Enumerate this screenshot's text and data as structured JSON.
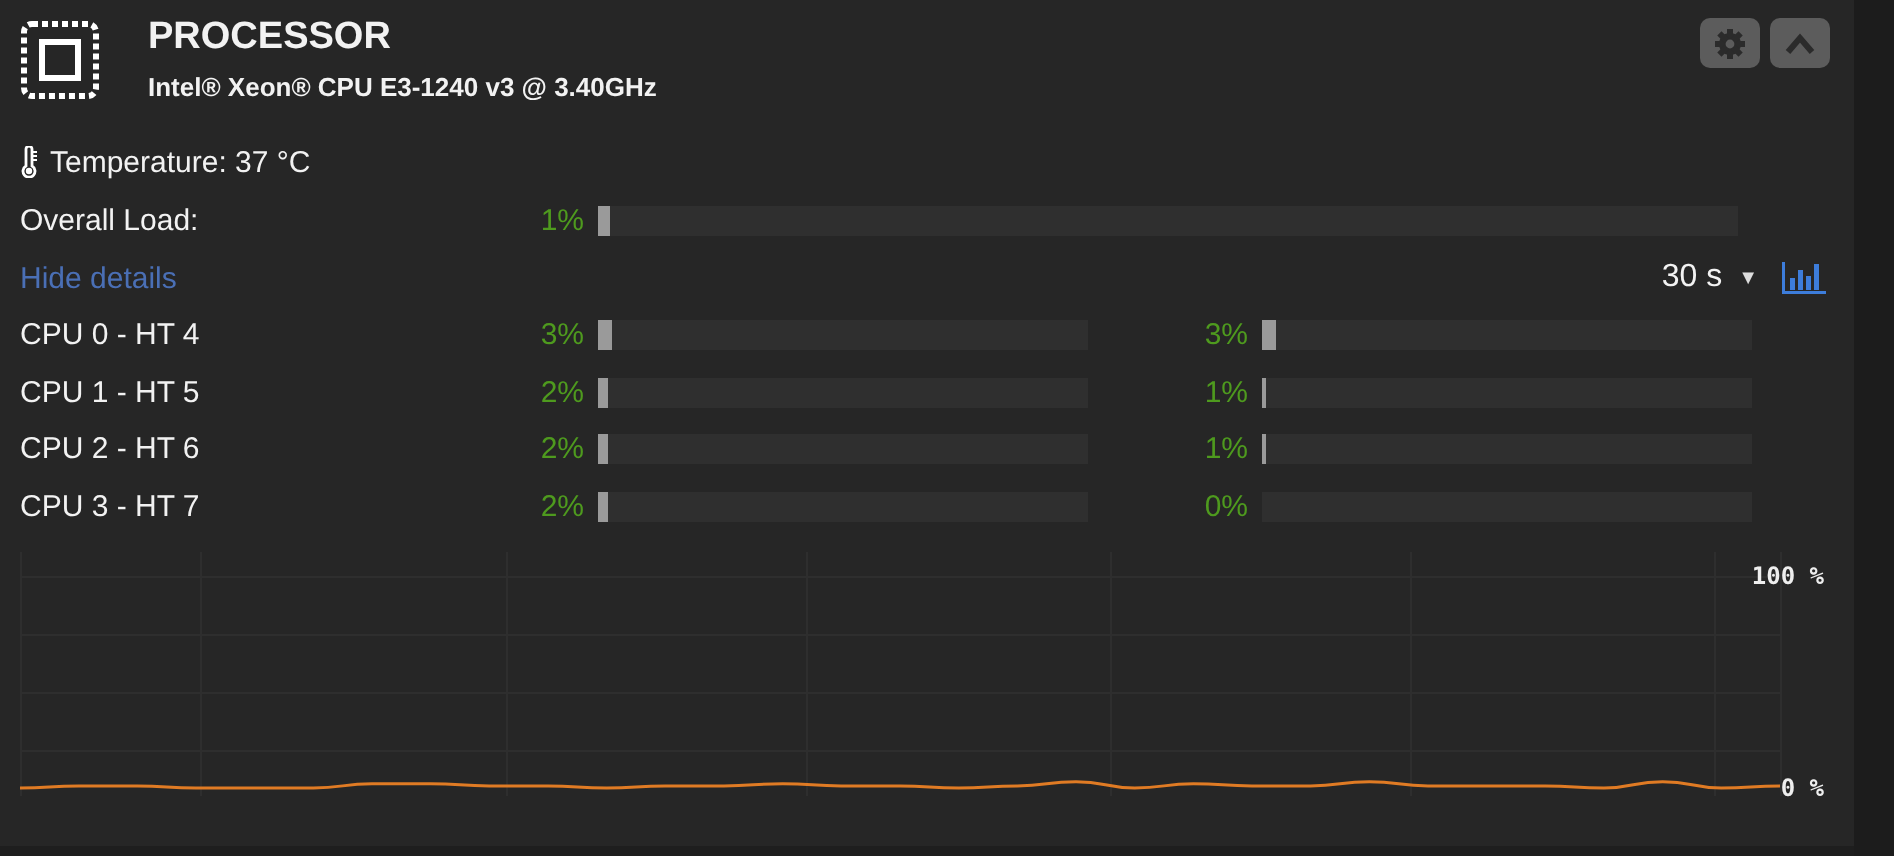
{
  "header": {
    "title": "PROCESSOR",
    "subtitle": "Intel® Xeon® CPU E3-1240 v3 @ 3.40GHz"
  },
  "temperature": "Temperature: 37 °C",
  "overall": {
    "label": "Overall Load:",
    "value": "1%",
    "level": 0.01
  },
  "details_link": "Hide details",
  "interval": {
    "value": "30 s",
    "caret": "▼"
  },
  "cpus": [
    {
      "label": "CPU 0 - HT 4",
      "left": {
        "value": "3%",
        "level": 0.03
      },
      "right": {
        "value": "3%",
        "level": 0.03
      }
    },
    {
      "label": "CPU 1 - HT 5",
      "left": {
        "value": "2%",
        "level": 0.02
      },
      "right": {
        "value": "1%",
        "level": 0.01
      }
    },
    {
      "label": "CPU 2 - HT 6",
      "left": {
        "value": "2%",
        "level": 0.02
      },
      "right": {
        "value": "1%",
        "level": 0.01
      }
    },
    {
      "label": "CPU 3 - HT 7",
      "left": {
        "value": "2%",
        "level": 0.02
      },
      "right": {
        "value": "0%",
        "level": 0
      }
    }
  ],
  "chart": {
    "chart_data": {
      "type": "line",
      "ylim": [
        0,
        100
      ],
      "yticks": [
        {
          "value": 100,
          "label": "100 %"
        },
        {
          "value": 0,
          "label": "0 %"
        }
      ],
      "series": [
        {
          "color": "#e07b24",
          "values": [
            0,
            1,
            1,
            0,
            0,
            0,
            2,
            2,
            1,
            1,
            0,
            1,
            1,
            2,
            1,
            1,
            0,
            1,
            3,
            0,
            2,
            1,
            1,
            3,
            1,
            1,
            1,
            0,
            3,
            0,
            1
          ]
        }
      ]
    }
  }
}
